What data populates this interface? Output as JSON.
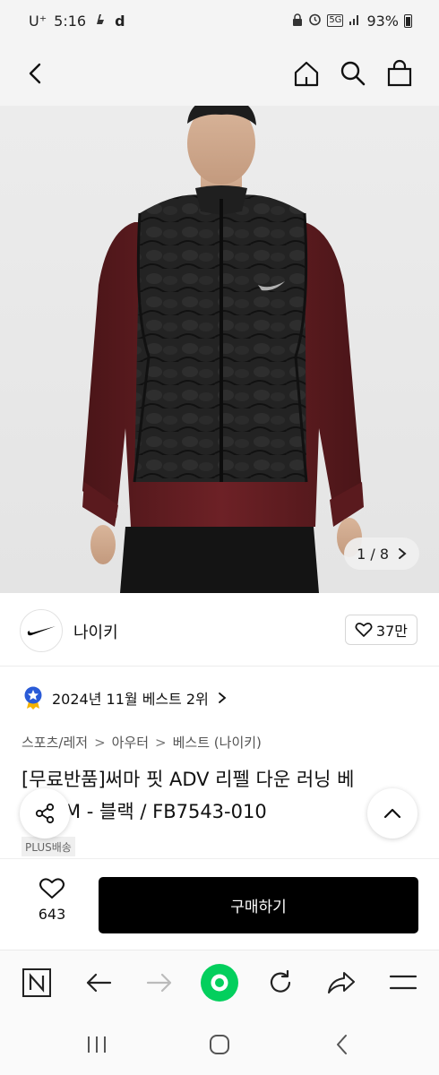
{
  "status_bar": {
    "carrier": "U⁺",
    "time": "5:16",
    "app_mark": "d",
    "network": "5G",
    "battery": "93%"
  },
  "nav": {
    "back_icon": "chevron-left-icon",
    "home_icon": "home-icon",
    "search_icon": "search-icon",
    "cart_icon": "shopping-bag-icon"
  },
  "gallery": {
    "current": "1",
    "separator": "/",
    "total": "8",
    "counter": "1 / 8"
  },
  "brand": {
    "name": "나이키",
    "like_count": "37만",
    "like_icon": "heart-icon"
  },
  "badge": {
    "text": "2024년 11월 베스트 2위",
    "icon": "medal-star-icon"
  },
  "breadcrumb": {
    "items": [
      "스포츠/레저",
      "아우터",
      "베스트 (나이키)"
    ],
    "separator": ">"
  },
  "product": {
    "title_line1": "[무료반품]써마 핏 ADV 리펠 다운 러닝 베",
    "title_line2": "M - 블랙 / FB7543-010",
    "shipping_tag": "PLUS배송"
  },
  "purchase": {
    "wish_count": "643",
    "buy_label": "구매하기"
  },
  "colors": {
    "buy_button": "#000000",
    "browser_accent": "#03cf5d",
    "background": "#ffffff",
    "topbar_bg": "#f4f4f4"
  }
}
